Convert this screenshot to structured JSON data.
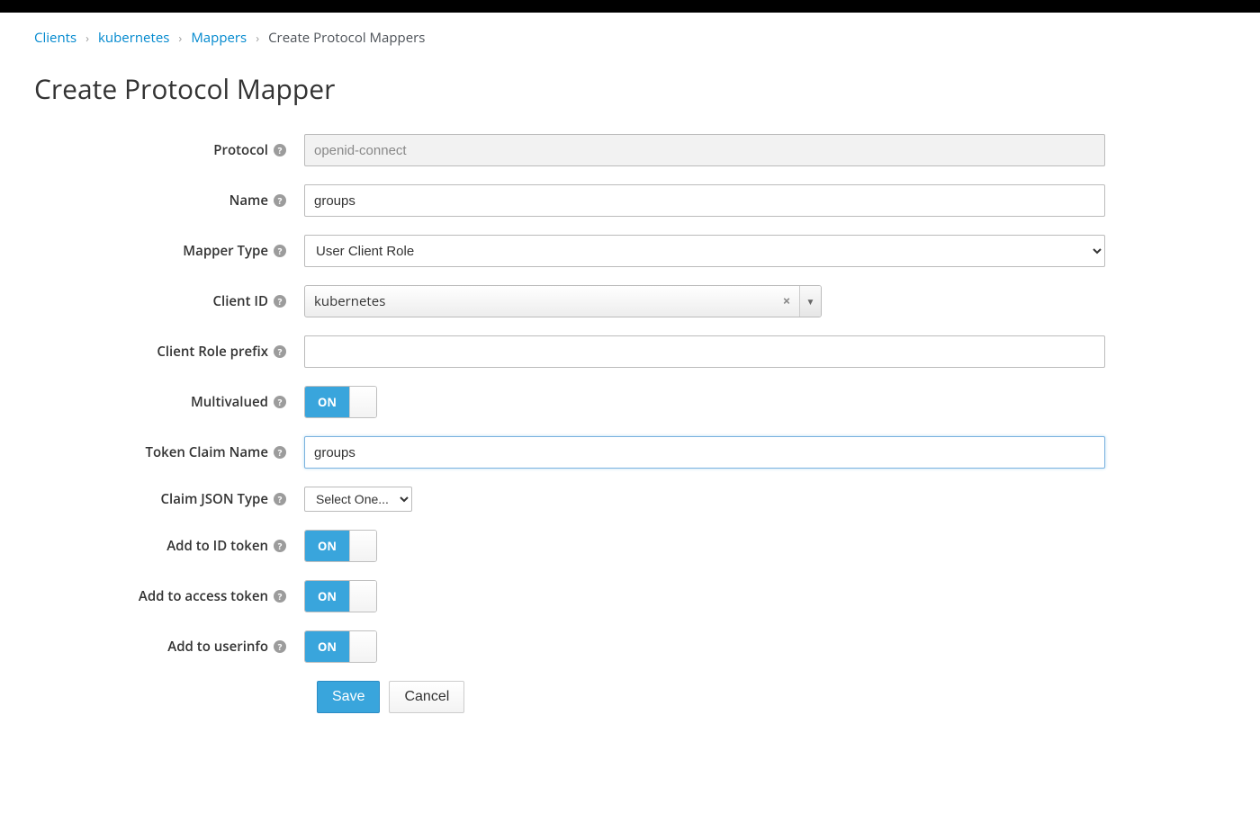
{
  "breadcrumb": {
    "items": [
      {
        "label": "Clients",
        "link": true
      },
      {
        "label": "kubernetes",
        "link": true
      },
      {
        "label": "Mappers",
        "link": true
      },
      {
        "label": "Create Protocol Mappers",
        "link": false
      }
    ]
  },
  "page": {
    "title": "Create Protocol Mapper"
  },
  "form": {
    "protocol": {
      "label": "Protocol",
      "value": "openid-connect"
    },
    "name": {
      "label": "Name",
      "value": "groups"
    },
    "mapperType": {
      "label": "Mapper Type",
      "value": "User Client Role"
    },
    "clientId": {
      "label": "Client ID",
      "value": "kubernetes"
    },
    "clientRolePrefix": {
      "label": "Client Role prefix",
      "value": ""
    },
    "multivalued": {
      "label": "Multivalued",
      "on_text": "ON"
    },
    "tokenClaimName": {
      "label": "Token Claim Name",
      "value": "groups"
    },
    "claimJsonType": {
      "label": "Claim JSON Type",
      "value": "Select One..."
    },
    "addIdToken": {
      "label": "Add to ID token",
      "on_text": "ON"
    },
    "addAccessToken": {
      "label": "Add to access token",
      "on_text": "ON"
    },
    "addUserinfo": {
      "label": "Add to userinfo",
      "on_text": "ON"
    }
  },
  "buttons": {
    "save": "Save",
    "cancel": "Cancel"
  }
}
